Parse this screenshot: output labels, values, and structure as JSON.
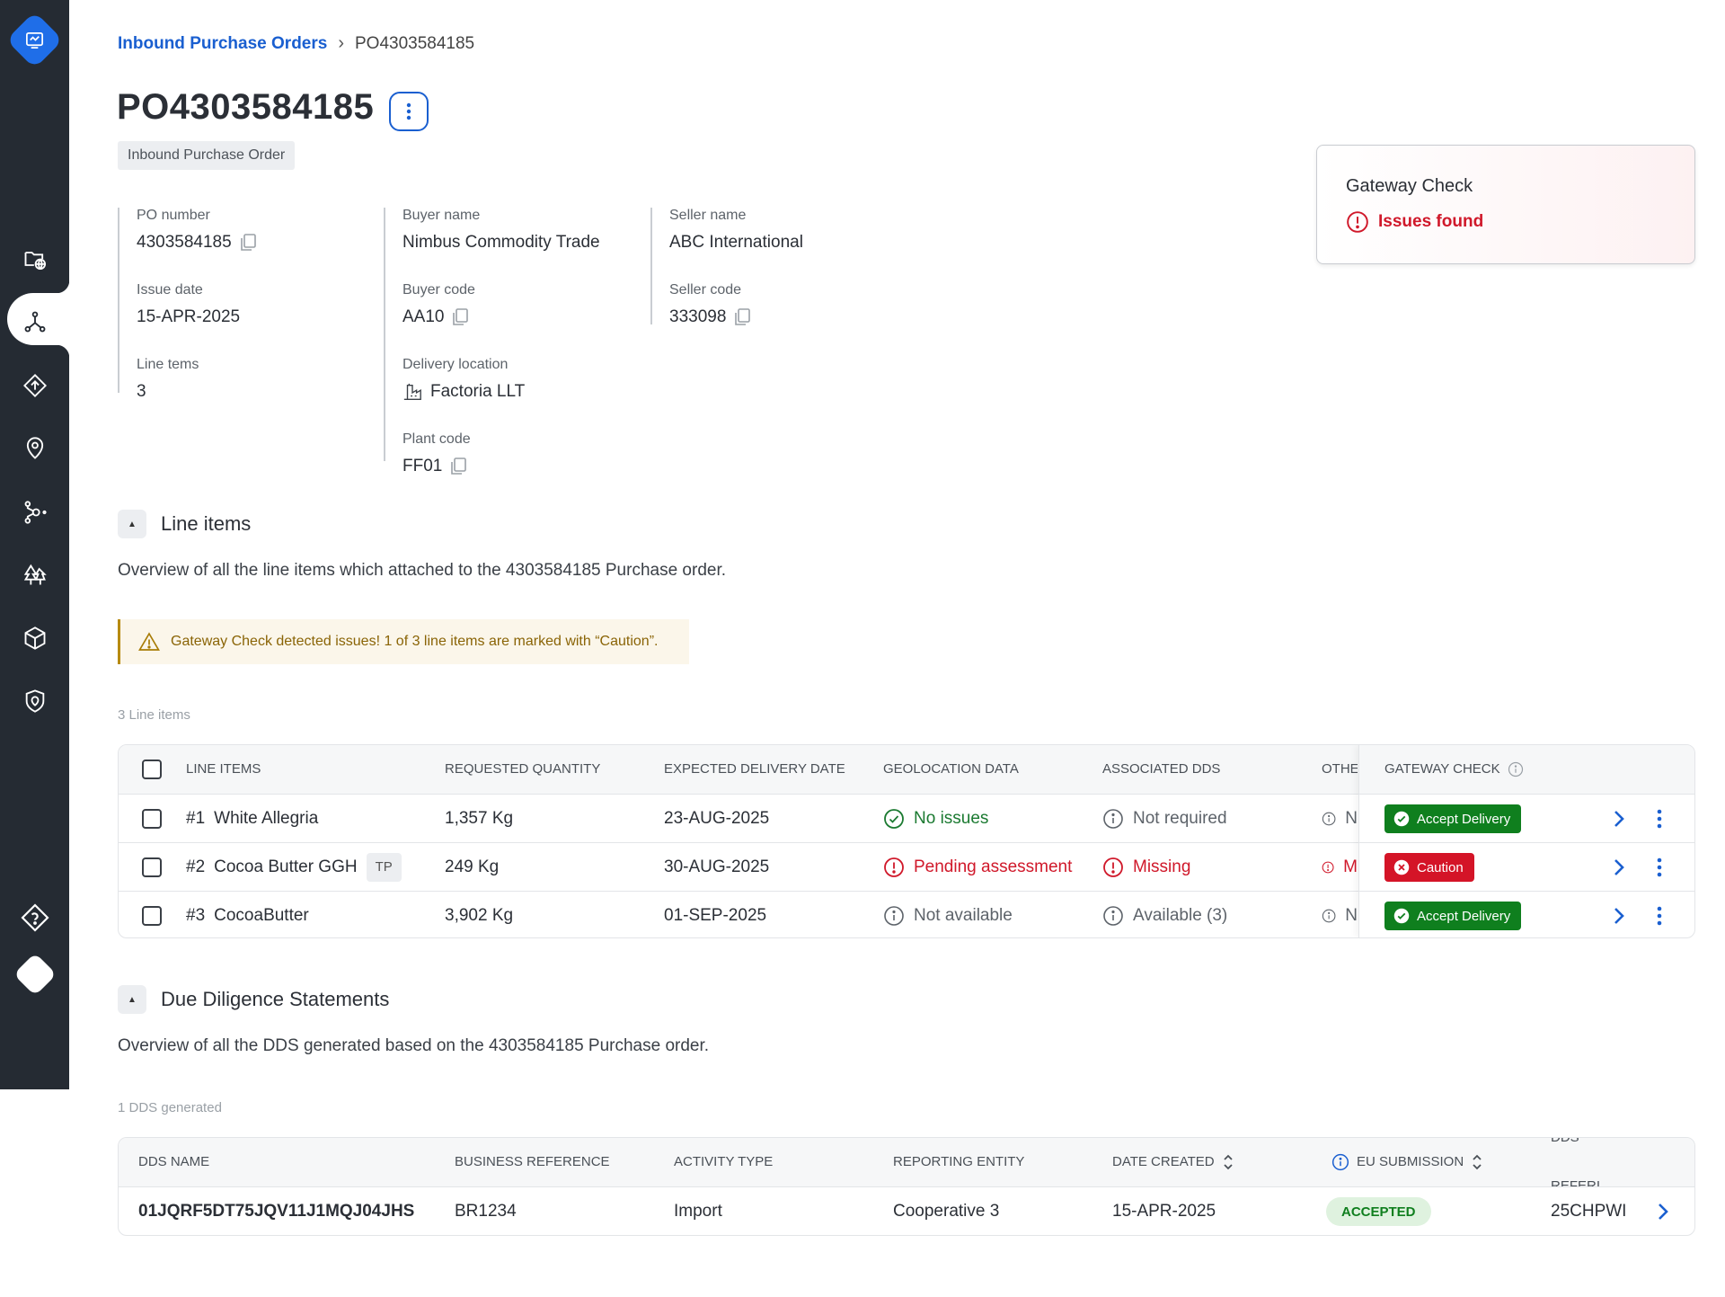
{
  "breadcrumb": {
    "parent": "Inbound Purchase Orders",
    "current": "PO4303584185"
  },
  "header": {
    "title": "PO4303584185",
    "type_badge": "Inbound Purchase Order"
  },
  "info": {
    "po_number_label": "PO number",
    "po_number": "4303584185",
    "issue_date_label": "Issue date",
    "issue_date": "15-APR-2025",
    "line_items_label": "Line tems",
    "line_items": "3",
    "buyer_name_label": "Buyer name",
    "buyer_name": "Nimbus Commodity Trade",
    "buyer_code_label": "Buyer code",
    "buyer_code": "AA10",
    "delivery_location_label": "Delivery location",
    "delivery_location": "Factoria LLT",
    "plant_code_label": "Plant code",
    "plant_code": "FF01",
    "seller_name_label": "Seller name",
    "seller_name": "ABC International",
    "seller_code_label": "Seller code",
    "seller_code": "333098"
  },
  "gateway": {
    "title": "Gateway Check",
    "status": "Issues found"
  },
  "line_items_section": {
    "title": "Line items",
    "description": "Overview of all the line items which attached to the 4303584185 Purchase order.",
    "alert": "Gateway Check detected issues!  1 of 3 line items are marked with “Caution”.",
    "count": "3 Line items",
    "columns": [
      "LINE ITEMS",
      "REQUESTED QUANTITY",
      "EXPECTED DELIVERY DATE",
      "GEOLOCATION DATA",
      "ASSOCIATED DDS",
      "OTHER",
      "GATEWAY CHECK"
    ],
    "rows": [
      {
        "num": "#1",
        "name": "White Allegria",
        "tag": "",
        "quantity": "1,357 Kg",
        "date": "23-AUG-2025",
        "geo": "No issues",
        "dds": "Not required",
        "other": "N",
        "gateway": "Accept Delivery"
      },
      {
        "num": "#2",
        "name": "Cocoa Butter GGH",
        "tag": "TP",
        "quantity": "249 Kg",
        "date": "30-AUG-2025",
        "geo": "Pending assessment",
        "dds": "Missing",
        "other": "M",
        "gateway": "Caution"
      },
      {
        "num": "#3",
        "name": "CocoaButter",
        "tag": "",
        "quantity": "3,902 Kg",
        "date": "01-SEP-2025",
        "geo": "Not available",
        "dds": "Available (3)",
        "other": "N",
        "gateway": "Accept Delivery"
      }
    ]
  },
  "dds_section": {
    "title": "Due Diligence Statements",
    "description": "Overview of all the DDS generated based on the 4303584185 Purchase order.",
    "count": "1 DDS generated",
    "columns": [
      "DDS NAME",
      "BUSINESS REFERENCE",
      "ACTIVITY TYPE",
      "REPORTING ENTITY",
      "DATE CREATED",
      "EU SUBMISSION",
      "DDS REFERI"
    ],
    "rows": [
      {
        "name": "01JQRF5DT75JQV11J1MQJ04JHS",
        "business_ref": "BR1234",
        "activity": "Import",
        "entity": "Cooperative 3",
        "date": "15-APR-2025",
        "submission": "ACCEPTED",
        "reference": "25CHPWI"
      }
    ]
  },
  "colors": {
    "accent": "#1a5fd0",
    "sidebar": "#252b33",
    "success": "#0f7f1e",
    "danger": "#d41427",
    "warning": "#b78a10"
  }
}
